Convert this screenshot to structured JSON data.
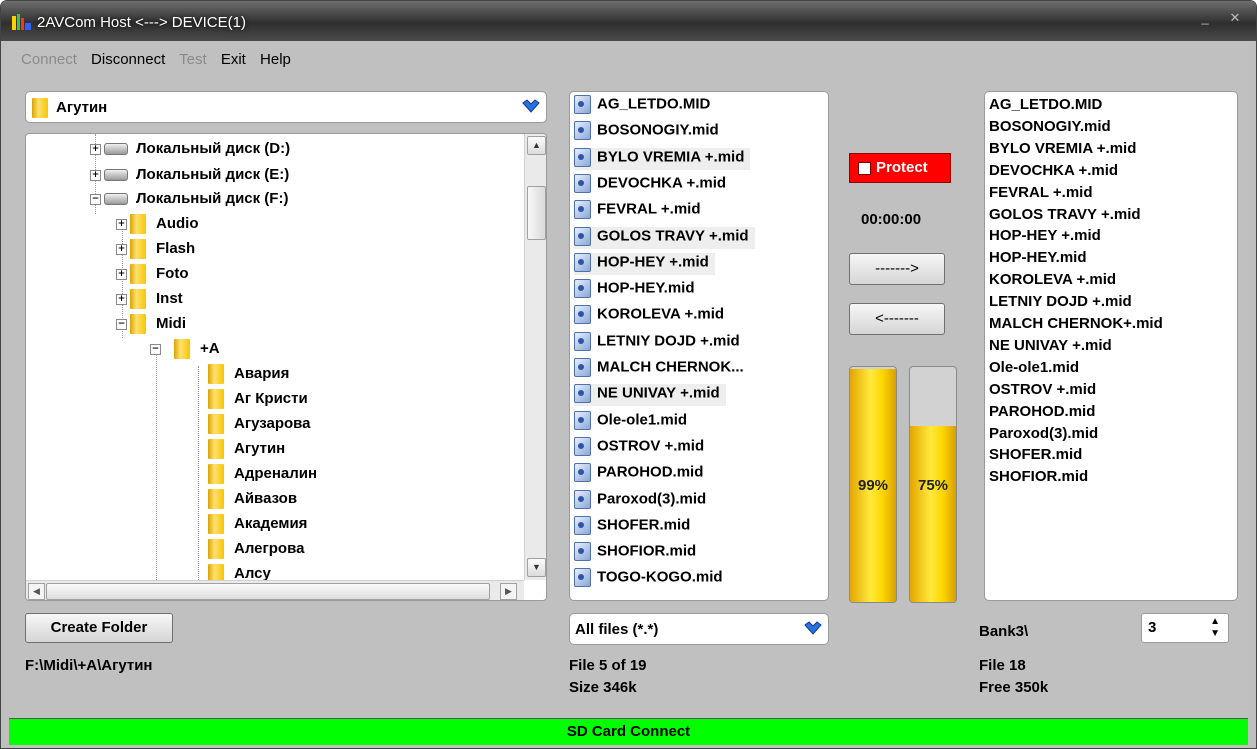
{
  "window": {
    "title": "2AVCom Host <---> DEVICE(1)",
    "accent": "#2e2e2e"
  },
  "menu": {
    "connect": "Connect",
    "disconnect": "Disconnect",
    "test": "Test",
    "exit": "Exit",
    "help": "Help"
  },
  "folder_combo": {
    "value": "Агутин"
  },
  "tree": {
    "drives": [
      "Локальный диск (D:)",
      "Локальный диск (E:)",
      "Локальный диск (F:)"
    ],
    "f_children": [
      "Audio",
      "Flash",
      "Foto",
      "Inst",
      "Midi"
    ],
    "midi_children": [
      "+A"
    ],
    "a_children": [
      "Авария",
      "Аг Кристи",
      "Агузарова",
      "Агутин",
      "Адреналин",
      "Айвазов",
      "Академия",
      "Алегрова",
      "Алсу"
    ]
  },
  "buttons": {
    "create_folder": "Create Folder",
    "to_device": "------->",
    "to_host": "<-------"
  },
  "current_path": "F:\\Midi\\+A\\Агутин",
  "host_files": [
    "AG_LETDO.MID",
    "BOSONOGIY.mid",
    "BYLO VREMIA +.mid",
    "DEVOCHKA +.mid",
    "FEVRAL +.mid",
    "GOLOS TRAVY +.mid",
    "HOP-HEY +.mid",
    "HOP-HEY.mid",
    "KOROLEVA +.mid",
    "LETNIY DOJD +.mid",
    "MALCH CHERNOK...",
    "NE UNIVAY +.mid",
    "Ole-ole1.mid",
    "OSTROV +.mid",
    "PAROHOD.mid",
    "Paroxod(3).mid",
    "SHOFER.mid",
    "SHOFIOR.mid",
    "TOGO-KOGO.mid"
  ],
  "filter": {
    "value": "All files (*.*)"
  },
  "host_status": {
    "file": "File 5 of 19",
    "size": "Size 346k"
  },
  "protect": {
    "label": "Protect",
    "color": "#ff0000"
  },
  "timer": "00:00:00",
  "levels": {
    "left": {
      "fraction": 0.99,
      "label": "99%"
    },
    "right": {
      "fraction": 0.75,
      "label": "75%"
    }
  },
  "device_files": [
    "AG_LETDO.MID",
    "BOSONOGIY.mid",
    "BYLO VREMIA +.mid",
    "DEVOCHKA +.mid",
    "FEVRAL +.mid",
    "GOLOS TRAVY +.mid",
    "HOP-HEY +.mid",
    "HOP-HEY.mid",
    "KOROLEVA +.mid",
    "LETNIY DOJD +.mid",
    "MALCH CHERNOK+.mid",
    "NE UNIVAY +.mid",
    "Ole-ole1.mid",
    "OSTROV +.mid",
    "PAROHOD.mid",
    "Paroxod(3).mid",
    "SHOFER.mid",
    "SHOFIOR.mid"
  ],
  "bank": {
    "label": "Bank3\\",
    "value": "3"
  },
  "device_status": {
    "file": "File 18",
    "free": "Free 350k"
  },
  "status_bar": {
    "text": "SD Card Connect",
    "color": "#00ff00"
  }
}
